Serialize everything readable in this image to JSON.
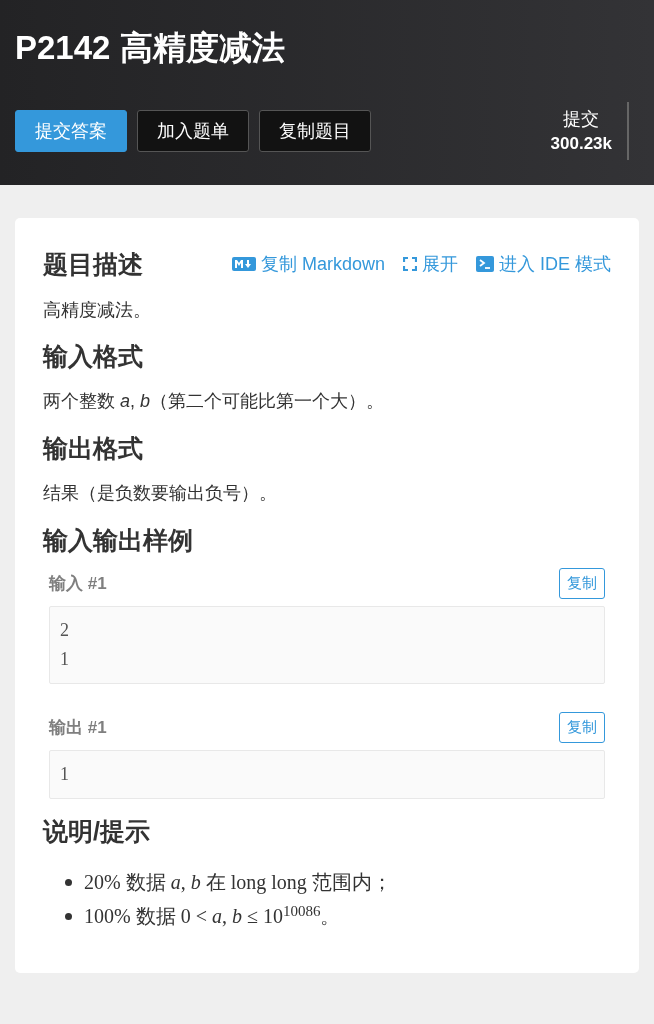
{
  "header": {
    "title": "P2142 高精度减法",
    "buttons": [
      {
        "label": "提交答案",
        "kind": "primary"
      },
      {
        "label": "加入题单",
        "kind": "dark"
      },
      {
        "label": "复制题目",
        "kind": "dark"
      }
    ],
    "stat": {
      "label": "提交",
      "value": "300.23k"
    }
  },
  "card": {
    "title": "题目描述",
    "actions": [
      {
        "label": "复制 Markdown",
        "kind": "markdown"
      },
      {
        "label": "展开",
        "kind": "expand"
      },
      {
        "label": "进入 IDE 模式",
        "kind": "ide"
      }
    ],
    "description": "高精度减法。",
    "sections": [
      {
        "kind": "text",
        "title": "输入格式",
        "text": "两个整数 *a*, *b*（第二个可能比第一个大）。"
      },
      {
        "kind": "text",
        "title": "输出格式",
        "text": "结果（是负数要输出负号）。"
      },
      {
        "kind": "samples",
        "title": "输入输出样例",
        "samples": [
          {
            "label": "输入 #1",
            "copy": "复制",
            "lines": [
              "2",
              "1"
            ]
          },
          {
            "label": "输出 #1",
            "copy": "复制",
            "lines": [
              "1"
            ]
          }
        ]
      },
      {
        "kind": "list",
        "title": "说明/提示",
        "items": [
          "20% 数据 *a*, *b* 在 long long 范围内；",
          "100% 数据 0 < *a*, *b* ≤ 10$^{10086}$。"
        ]
      }
    ]
  }
}
